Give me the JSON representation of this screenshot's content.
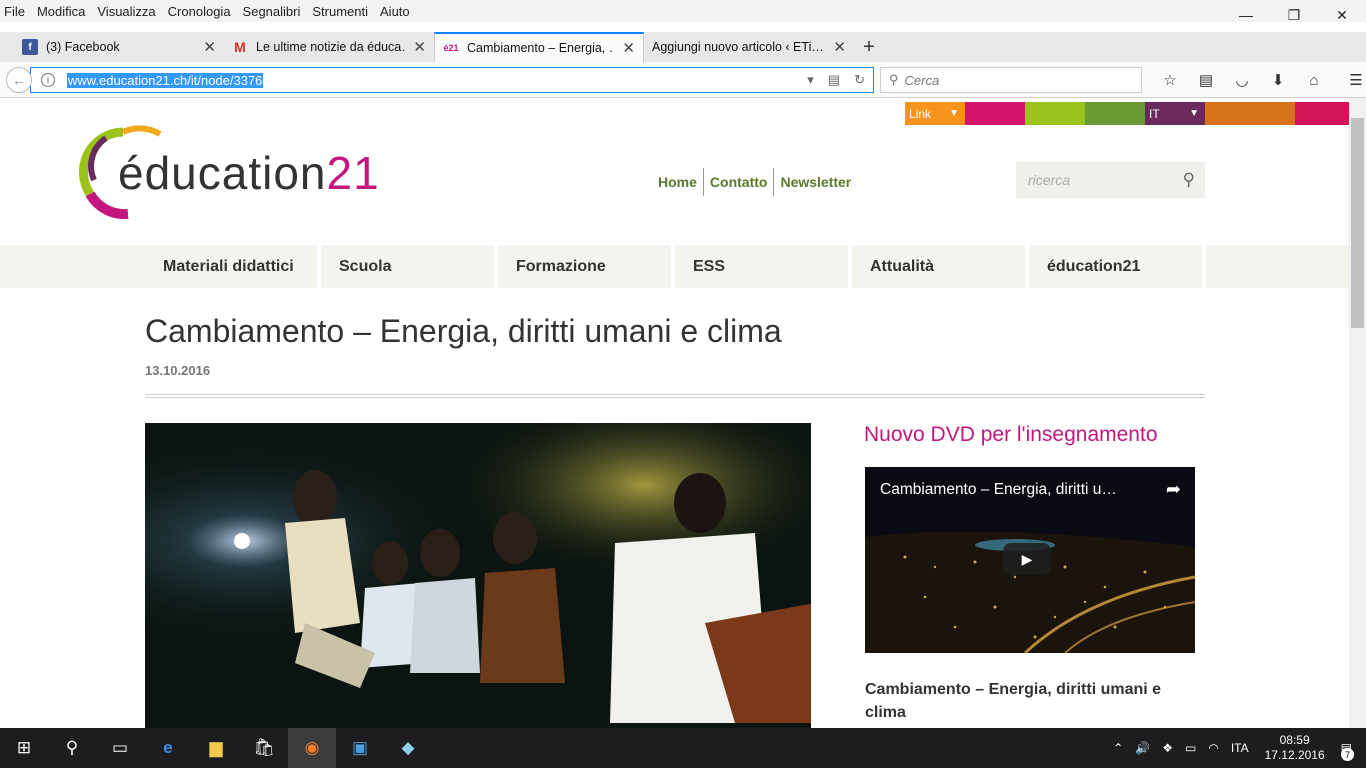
{
  "menubar": [
    "File",
    "Modifica",
    "Visualizza",
    "Cronologia",
    "Segnalibri",
    "Strumenti",
    "Aiuto"
  ],
  "tabs": [
    {
      "label": "(3) Facebook",
      "icon": "facebook-icon"
    },
    {
      "label": "Le ultime notizie da éduca…",
      "icon": "gmail-icon"
    },
    {
      "label": "Cambiamento – Energia, …",
      "icon": "education21-icon"
    },
    {
      "label": "Aggiungi nuovo articolo ‹ ETi…",
      "icon": "blank-icon"
    }
  ],
  "url": "www.education21.ch/it/node/3376",
  "browser_search_placeholder": "Cerca",
  "site": {
    "strip": {
      "link_label": "Link",
      "lang_label": "IT"
    },
    "logo": {
      "text_main": "éducation",
      "text_num": "21"
    },
    "toplinks": [
      "Home",
      "Contatto",
      "Newsletter"
    ],
    "search_placeholder": "ricerca",
    "nav": [
      "Materiali didattici",
      "Scuola",
      "Formazione",
      "ESS",
      "Attualità",
      "éducation21"
    ],
    "article": {
      "title": "Cambiamento – Energia, diritti umani e clima",
      "date": "13.10.2016"
    },
    "sidebar": {
      "heading": "Nuovo DVD per l'insegnamento",
      "video_title": "Cambiamento – Energia, diritti u…",
      "caption": "Cambiamento – Energia, diritti umani e clima"
    }
  },
  "taskbar": {
    "lang": "ITA",
    "time": "08:59",
    "date": "17.12.2016",
    "notifications": "7"
  },
  "colors": {
    "brand_magenta": "#c3177f",
    "brand_green": "#5a7a2a",
    "orange": "#f7941d"
  }
}
